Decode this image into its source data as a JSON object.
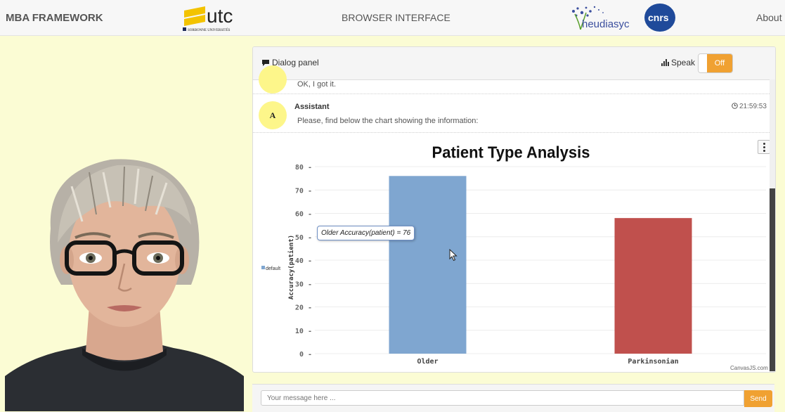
{
  "navbar": {
    "brand": "MBA FRAMEWORK",
    "utc_logo_text": "utc",
    "utc_logo_sub": "SORBONNE UNIVERSITÉS",
    "center_title": "BROWSER INTERFACE",
    "heudiasyc_logo_text": "heudiasyc",
    "cnrs_logo_text": "cnrs",
    "about": "About"
  },
  "dialog": {
    "title": "Dialog panel",
    "speak_label": "Speak",
    "speak_state": "Off",
    "messages": [
      {
        "text": "OK, I got it."
      },
      {
        "avatar_letter": "A",
        "author": "Assistant",
        "time": "21:59:53",
        "text": "Please, find below the chart showing the information:"
      }
    ]
  },
  "chart_data": {
    "type": "bar",
    "title": "Patient Type Analysis",
    "categories": [
      "Older",
      "Parkinsonian"
    ],
    "series": [
      {
        "name": "default",
        "values": [
          76,
          58
        ],
        "colors": [
          "#7fa6d0",
          "#c0504d"
        ]
      }
    ],
    "ylabel": "Accuracy(patient)",
    "xlabel": "",
    "ylim": [
      0,
      80
    ],
    "yticks": [
      0,
      10,
      20,
      30,
      40,
      50,
      60,
      70,
      80
    ],
    "grid": true,
    "legend_position": "left",
    "tooltip": "Older Accuracy(patient) = 76",
    "credit": "CanvasJS.com"
  },
  "input": {
    "placeholder": "Your message here ...",
    "send_label": "Send"
  },
  "colors": {
    "page_background": "#fbfcd4",
    "accent": "#f0a132",
    "bubble": "#fdf68a"
  }
}
